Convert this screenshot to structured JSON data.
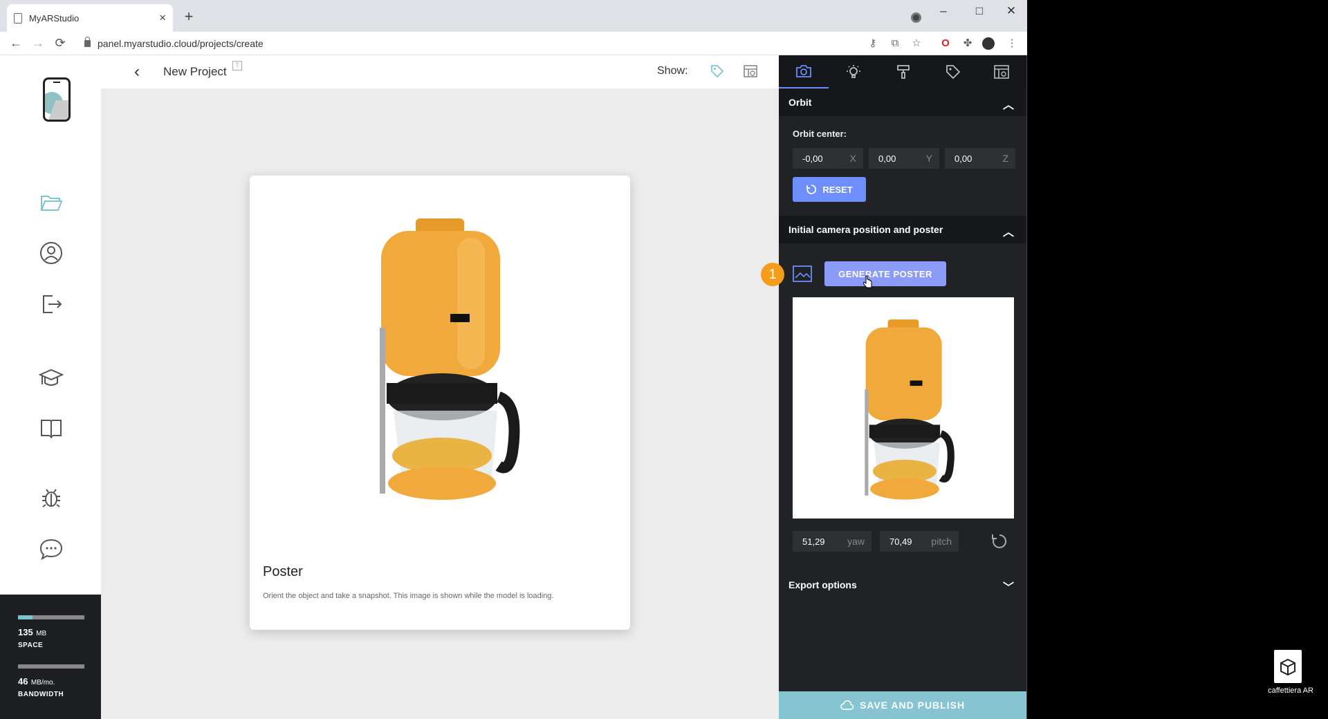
{
  "browser": {
    "tab_title": "MyARStudio",
    "tab_close": "×",
    "new_tab": "+",
    "url": "panel.myarstudio.cloud/projects/create",
    "window_minimize": "–",
    "window_maximize": "□",
    "window_close": "✕"
  },
  "sidebar": {
    "items": [
      {
        "icon": "folder-icon"
      },
      {
        "icon": "user-icon"
      },
      {
        "icon": "logout-icon"
      },
      {
        "icon": "graduation-cap-icon"
      },
      {
        "icon": "book-icon"
      },
      {
        "icon": "bug-icon"
      },
      {
        "icon": "chat-icon"
      }
    ],
    "usage": {
      "space_value": "135",
      "space_unit": "MB",
      "space_label": "SPACE",
      "space_fraction": 0.22,
      "bandwidth_value": "46",
      "bandwidth_unit": "MB/mo.",
      "bandwidth_label": "BANDWIDTH",
      "bandwidth_fraction": 0.0
    }
  },
  "header": {
    "title": "New Project",
    "show_label": "Show:"
  },
  "card": {
    "title": "Poster",
    "description": "Orient the object and take a snapshot. This image is shown while the model is loading."
  },
  "panel": {
    "orbit": {
      "title": "Orbit",
      "center_label": "Orbit center:",
      "x_value": "-0,00",
      "x_axis": "X",
      "y_value": "0,00",
      "y_axis": "Y",
      "z_value": "0,00",
      "z_axis": "Z",
      "reset_label": "RESET"
    },
    "camera": {
      "title": "Initial camera position and poster",
      "generate_label": "GENERATE POSTER",
      "yaw_value": "51,29",
      "yaw_unit": "yaw",
      "pitch_value": "70,49",
      "pitch_unit": "pitch"
    },
    "export": {
      "title": "Export options"
    },
    "save_label": "SAVE AND PUBLISH"
  },
  "annotation": {
    "step": "1"
  },
  "desktop": {
    "file_label": "caffettiera AR"
  },
  "colors": {
    "accent": "#6e8efb",
    "save": "#86c4d2",
    "badge": "#f59c1a",
    "coffee_body": "#f2a93b"
  }
}
